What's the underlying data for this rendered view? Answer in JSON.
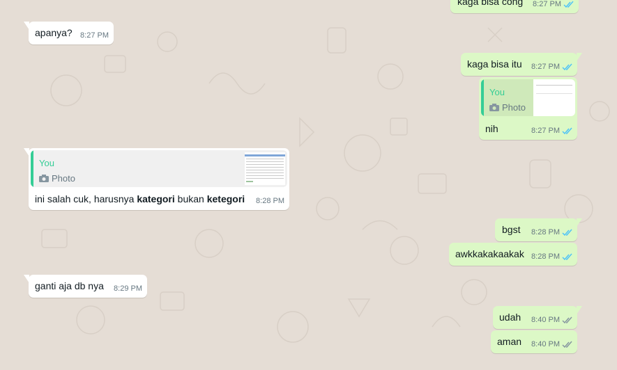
{
  "colors": {
    "background": "#e5ddd5",
    "incoming_bubble": "#ffffff",
    "outgoing_bubble": "#dcf8c6",
    "quote_accent": "#35cd96",
    "read_ticks": "#4fc3f7",
    "delivered_ticks": "#8696a0"
  },
  "messages": [
    {
      "id": "m1",
      "direction": "out",
      "text": "kaga bisa cong",
      "time": "8:27 PM",
      "status": "read"
    },
    {
      "id": "m2",
      "direction": "in",
      "text": "apanya?",
      "time": "8:27 PM"
    },
    {
      "id": "m3",
      "direction": "out",
      "text": "kaga bisa itu",
      "time": "8:27 PM",
      "status": "read"
    },
    {
      "id": "m4",
      "direction": "out",
      "quote": {
        "author": "You",
        "type": "Photo"
      },
      "text": "nih",
      "time": "8:27 PM",
      "status": "read"
    },
    {
      "id": "m5",
      "direction": "in",
      "quote": {
        "author": "You",
        "type": "Photo"
      },
      "text_parts": [
        "ini salah cuk, harusnya ",
        "kategori",
        " bukan ",
        "ketegori"
      ],
      "time": "8:28 PM"
    },
    {
      "id": "m6",
      "direction": "out",
      "text": "bgst",
      "time": "8:28 PM",
      "status": "read"
    },
    {
      "id": "m7",
      "direction": "out",
      "text": "awkkakakaakak",
      "time": "8:28 PM",
      "status": "read"
    },
    {
      "id": "m8",
      "direction": "in",
      "text": "ganti aja db nya",
      "time": "8:29 PM"
    },
    {
      "id": "m9",
      "direction": "out",
      "text": "udah",
      "time": "8:40 PM",
      "status": "delivered"
    },
    {
      "id": "m10",
      "direction": "out",
      "text": "aman",
      "time": "8:40 PM",
      "status": "delivered"
    }
  ]
}
